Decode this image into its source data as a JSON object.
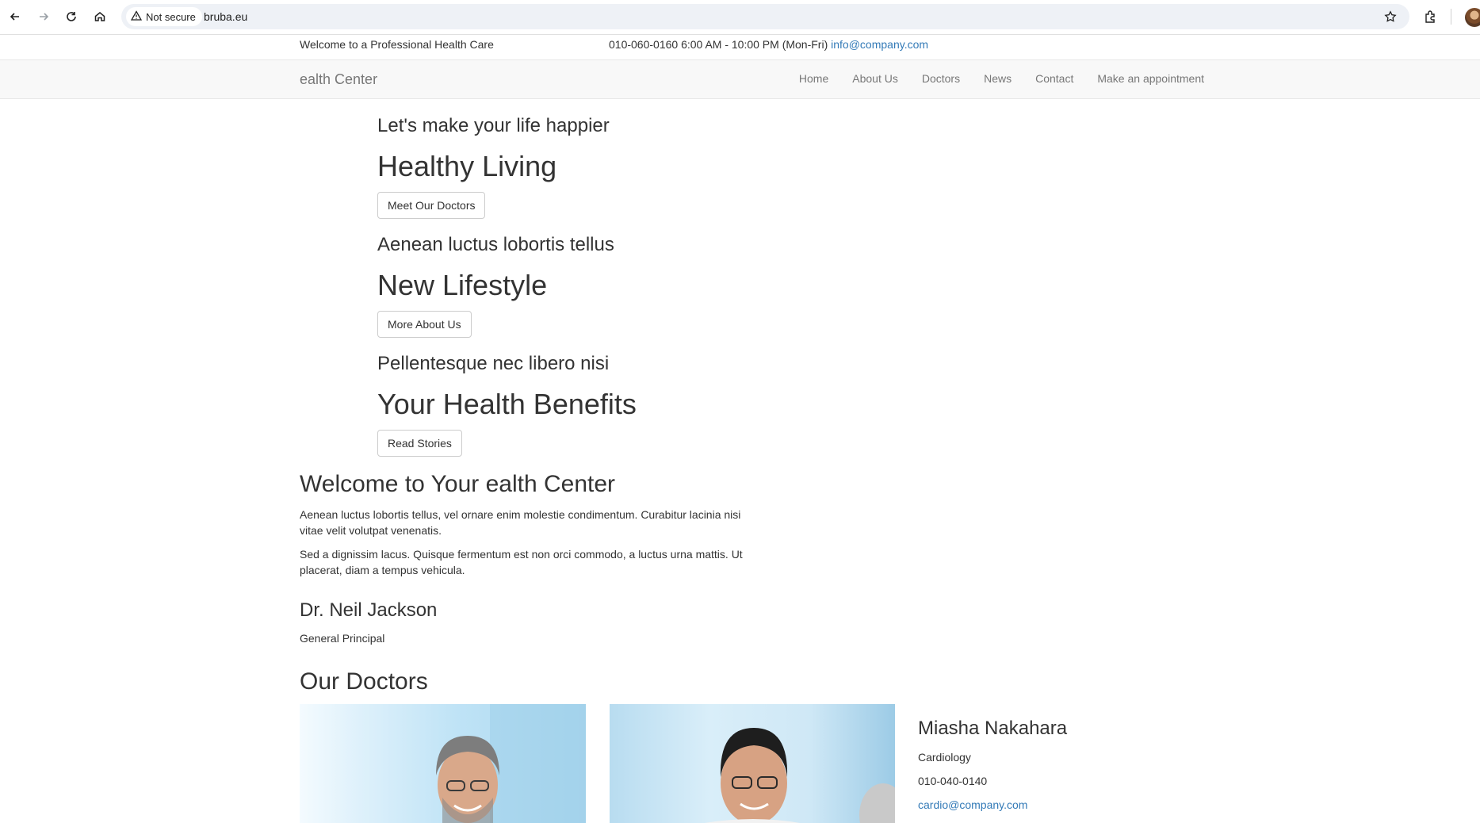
{
  "browser": {
    "security_label": "Not secure",
    "url": "bruba.eu"
  },
  "topbar": {
    "welcome": "Welcome to a Professional Health Care",
    "contact_text": "010-060-0160 6:00 AM - 10:00 PM (Mon-Fri)",
    "email": "info@company.com"
  },
  "navbar": {
    "brand": "ealth Center",
    "items": [
      "Home",
      "About Us",
      "Doctors",
      "News",
      "Contact",
      "Make an appointment"
    ]
  },
  "slides": [
    {
      "subtitle": "Let's make your life happier",
      "title": "Healthy Living",
      "button": "Meet Our Doctors"
    },
    {
      "subtitle": "Aenean luctus lobortis tellus",
      "title": "New Lifestyle",
      "button": "More About Us"
    },
    {
      "subtitle": "Pellentesque nec libero nisi",
      "title": "Your Health Benefits",
      "button": "Read Stories"
    }
  ],
  "welcome": {
    "title": "Welcome to Your ealth Center",
    "paragraph1": "Aenean luctus lobortis tellus, vel ornare enim molestie condimentum. Curabitur lacinia nisi vitae velit volutpat venenatis.",
    "paragraph2": "Sed a dignissim lacus. Quisque fermentum est non orci commodo, a luctus urna mattis. Ut placerat, diam a tempus vehicula.",
    "doctor_name": "Dr. Neil Jackson",
    "doctor_role": "General Principal"
  },
  "doctors": {
    "title": "Our Doctors",
    "card": {
      "name": "Miasha Nakahara",
      "specialty": "Cardiology",
      "phone": "010-040-0140",
      "email": "cardio@company.com"
    }
  }
}
